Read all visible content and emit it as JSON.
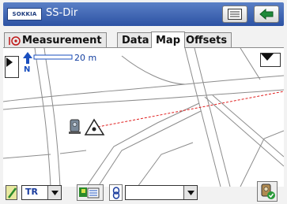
{
  "titlebar": {
    "logo_text": "SOKKIA",
    "title": "SS-Dir",
    "buttons": [
      {
        "name": "menu-list-icon"
      },
      {
        "name": "back-arrow-icon"
      }
    ]
  },
  "tabs": [
    {
      "label": "Measurement",
      "icon": "survey-prism-icon",
      "active": false
    },
    {
      "label": "Data",
      "active": false
    },
    {
      "label": "Map",
      "active": true
    },
    {
      "label": "Offsets",
      "active": false
    }
  ],
  "map": {
    "scale_label": "20 m",
    "north_label": "N",
    "colors": {
      "roads": "#8c8c8c",
      "sight_line": "#e02020",
      "scale": "#1a4fbf",
      "instrument": "#7a8a9a"
    }
  },
  "bottom_bar": {
    "mode_combo_value": "TR",
    "filter_combo_value": "",
    "icons": [
      "pencil-icon",
      "layer-select-icon",
      "link-icon",
      "instrument-ok-icon"
    ]
  }
}
